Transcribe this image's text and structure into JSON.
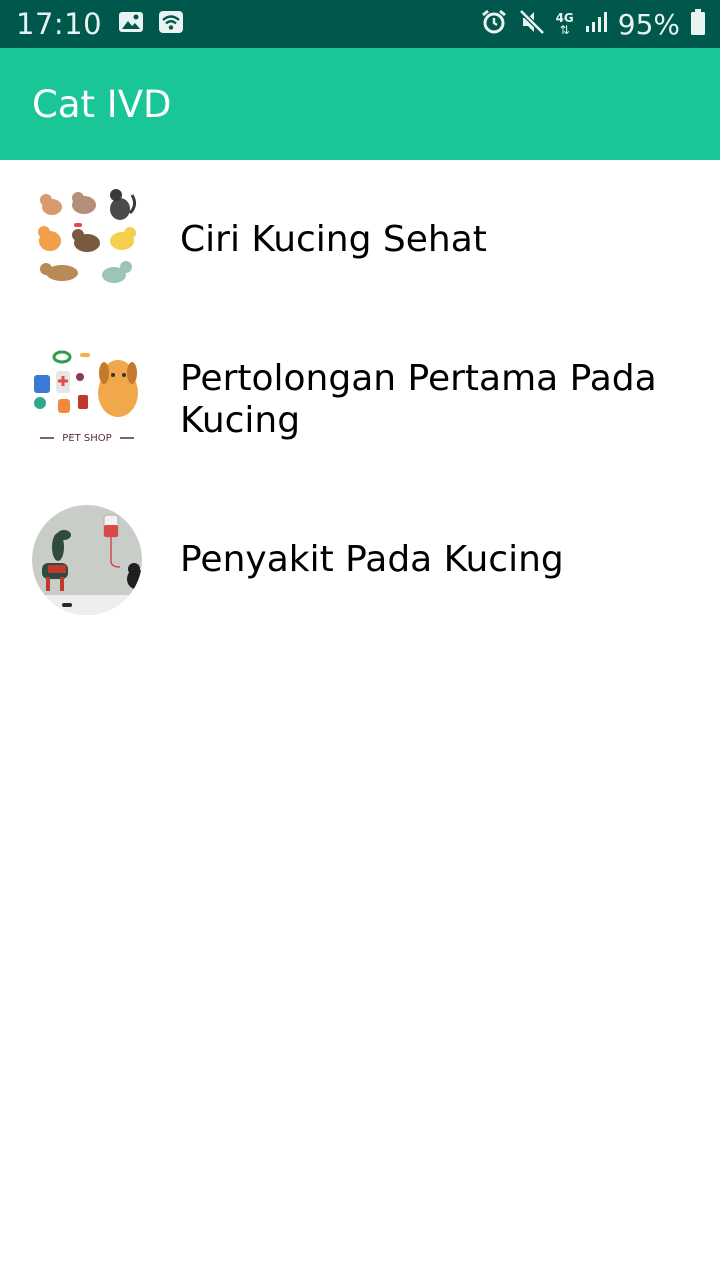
{
  "status_bar": {
    "time": "17:10",
    "network": "4G",
    "battery_percent": "95%",
    "icons_left": [
      "image-icon",
      "wifi-icon"
    ],
    "icons_right": [
      "alarm-icon",
      "mute-icon",
      "network-4g-icon",
      "signal-icon",
      "battery-icon"
    ]
  },
  "app_bar": {
    "title": "Cat IVD",
    "color": "#1ac698"
  },
  "menu": {
    "items": [
      {
        "label": "Ciri Kucing Sehat",
        "thumb": "cats-collage-image"
      },
      {
        "label": "Pertolongan Pertama Pada Kucing",
        "thumb": "pet-shop-image",
        "thumb_caption": "PET SHOP"
      },
      {
        "label": "Penyakit Pada Kucing",
        "thumb": "vet-clinic-image"
      }
    ]
  }
}
